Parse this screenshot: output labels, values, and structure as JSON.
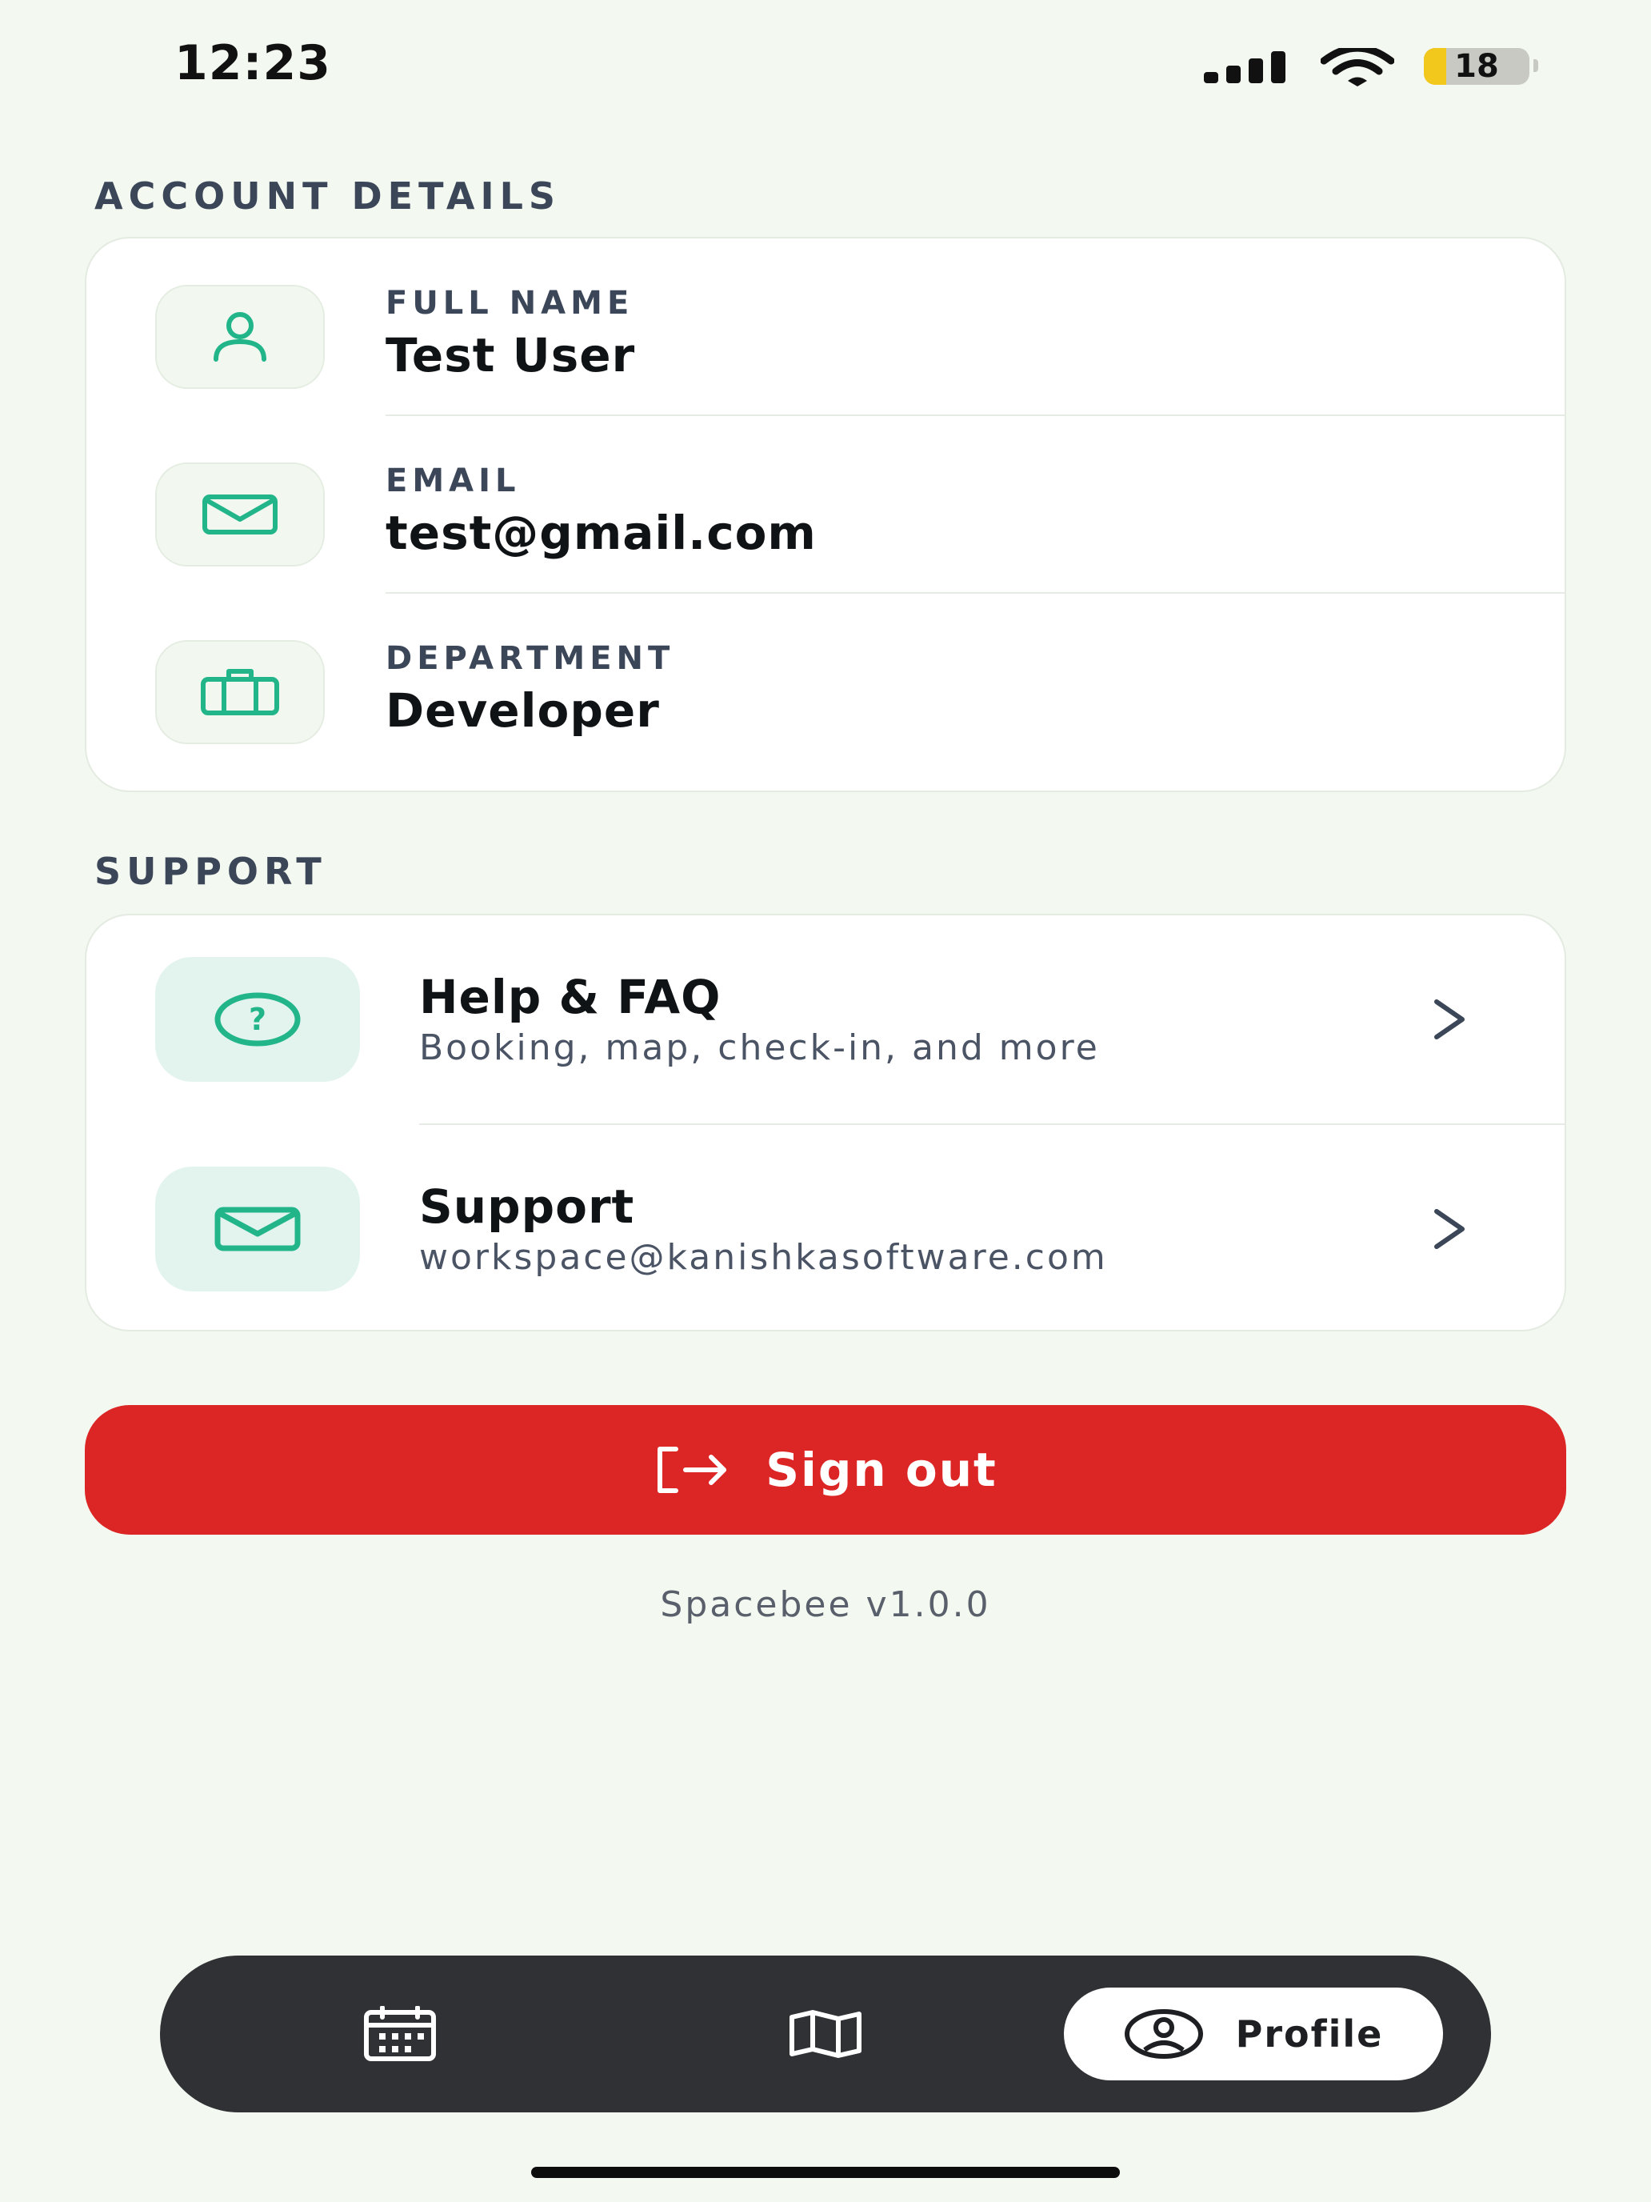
{
  "status_bar": {
    "time": "12:23",
    "battery": "18"
  },
  "account": {
    "section_title": "ACCOUNT DETAILS",
    "rows": [
      {
        "label": "FULL NAME",
        "value": "Test User",
        "icon": "user-icon"
      },
      {
        "label": "EMAIL",
        "value": "test@gmail.com",
        "icon": "mail-icon"
      },
      {
        "label": "DEPARTMENT",
        "value": "Developer",
        "icon": "briefcase-icon"
      }
    ]
  },
  "support": {
    "section_title": "SUPPORT",
    "items": [
      {
        "title": "Help & FAQ",
        "subtitle": "Booking, map, check-in, and more",
        "icon": "help-circle-icon"
      },
      {
        "title": "Support",
        "subtitle": "workspace@kanishkasoftware.com",
        "icon": "mail-icon"
      }
    ]
  },
  "sign_out": {
    "label": "Sign out",
    "icon": "logout-icon"
  },
  "version": "Spacebee v1.0.0",
  "tabbar": {
    "tabs": [
      {
        "name": "calendar",
        "icon": "calendar-icon"
      },
      {
        "name": "map",
        "icon": "map-icon"
      },
      {
        "name": "profile",
        "label": "Profile",
        "icon": "profile-icon",
        "active": true
      }
    ]
  },
  "colors": {
    "background": "#f3f8f0",
    "accent": "#22b58a",
    "danger": "#dc2626",
    "tabbar": "#2f3135"
  }
}
